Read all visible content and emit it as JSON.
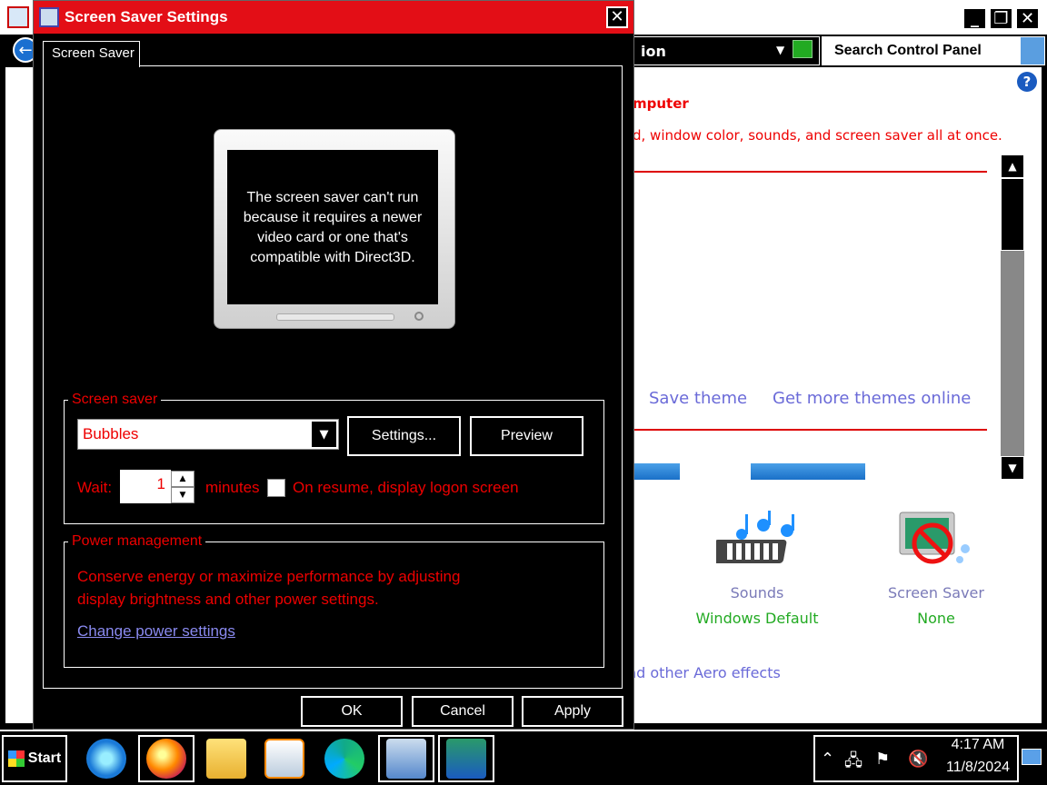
{
  "dialog": {
    "title": "Screen Saver Settings",
    "close_label": "✕",
    "tab_label": "Screen Saver",
    "preview_message": "The screen saver can't run because it requires a newer video card or one that's compatible with Direct3D.",
    "screen_saver_group": "Screen saver",
    "selected_saver": "Bubbles",
    "settings_label": "Settings...",
    "preview_label": "Preview",
    "wait_label": "Wait:",
    "wait_value": "1",
    "minutes_label": "minutes",
    "resume_label": "On resume, display logon screen",
    "resume_checked": false,
    "power_group": "Power management",
    "power_desc": "Conserve energy or maximize performance by adjusting display brightness and other power settings.",
    "power_link": "Change power settings",
    "ok_label": "OK",
    "cancel_label": "Cancel",
    "apply_label": "Apply"
  },
  "control_panel": {
    "address_text": "ion",
    "search_placeholder": "Search Control Panel",
    "help_label": "?",
    "heading": "mputer",
    "description": "d, window color, sounds, and screen saver all at once.",
    "save_theme": "Save theme",
    "get_more_themes": "Get more themes online",
    "items": [
      {
        "label": "Sounds",
        "value": "Windows Default",
        "icon": "sounds-icon"
      },
      {
        "label": "Screen Saver",
        "value": "None",
        "icon": "screen-saver-icon"
      }
    ],
    "partial_dots": "..",
    "aero_text": "nd other Aero effects"
  },
  "taskbar": {
    "start_label": "Start",
    "apps": [
      "internet-explorer-icon",
      "firefox-icon",
      "file-explorer-icon",
      "media-player-icon",
      "edge-icon",
      "control-panel-icon",
      "screen-saver-settings-icon"
    ],
    "time": "4:17 AM",
    "date": "11/8/2024"
  },
  "colors": {
    "title_red": "#e30e16",
    "text_red": "#e00",
    "link_blue": "#8a8af0",
    "value_green": "#2a2"
  }
}
